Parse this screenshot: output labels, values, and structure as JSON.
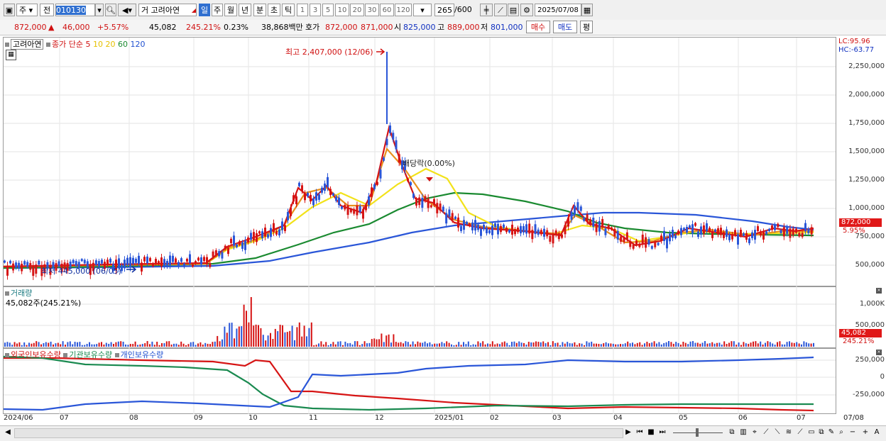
{
  "toolbar": {
    "market": "주",
    "prev": "전",
    "code": "010130",
    "name": "고려아연",
    "period_tabs": [
      "거",
      "일",
      "주",
      "월",
      "년",
      "분",
      "초",
      "틱"
    ],
    "active_period": "일",
    "intervals": [
      "1",
      "3",
      "5",
      "10",
      "20",
      "30",
      "60",
      "120"
    ],
    "count": "265",
    "count_max": "/600",
    "date": "2025/07/08"
  },
  "quote": {
    "price": "872,000",
    "arrow": "▲",
    "change": "46,000",
    "change_pct": "+5.57%",
    "volume": "45,082",
    "volume_pct": "245.21%",
    "turnover": "0.23%",
    "amount": "38,868백만",
    "ask_label": "호가",
    "ask": "872,000",
    "bid": "871,000",
    "open_label": "시",
    "open": "825,000",
    "high_label": "고",
    "high": "889,000",
    "low_label": "저",
    "low": "801,000",
    "buy_btn": "매수",
    "sell_btn": "매도",
    "flat_btn": "평"
  },
  "price_panel": {
    "stock_label": "고려아연",
    "ma_label": "종가 단순",
    "ma_periods": [
      {
        "p": "5",
        "color": "#d01010"
      },
      {
        "p": "10",
        "color": "#e08a1a"
      },
      {
        "p": "20",
        "color": "#f0e010"
      },
      {
        "p": "60",
        "color": "#1a8a30"
      },
      {
        "p": "120",
        "color": "#2050d0"
      }
    ],
    "max_note": "최고 2,407,000 (12/06)",
    "min_note": "최저 445,000 (06/05)",
    "dividend_note": "배당락(0.00%)",
    "lc": "LC:95.96",
    "hc": "HC:-63.77",
    "y_ticks": [
      "2,250,000",
      "2,000,000",
      "1,750,000",
      "1,500,000",
      "1,250,000",
      "1,000,000",
      "750,000",
      "500,000"
    ],
    "last_price_tag": "872,000",
    "last_pct_tag": "5.95%"
  },
  "volume_panel": {
    "title": "거래량",
    "value": "45,082주(245.21%)",
    "y_ticks": [
      "1,000K",
      "500,000"
    ],
    "tag_vol": "45,082",
    "tag_pct": "245.21%"
  },
  "holding_panel": {
    "series": [
      "외국인보유수량",
      "기관보유수량",
      "개인보유수량"
    ],
    "y_ticks": [
      "250,000",
      "0",
      "-250,000"
    ]
  },
  "x_axis": [
    "2024/06",
    "07",
    "08",
    "09",
    "10",
    "11",
    "12",
    "2025/01",
    "02",
    "03",
    "04",
    "05",
    "06",
    "07",
    "07/08"
  ]
}
